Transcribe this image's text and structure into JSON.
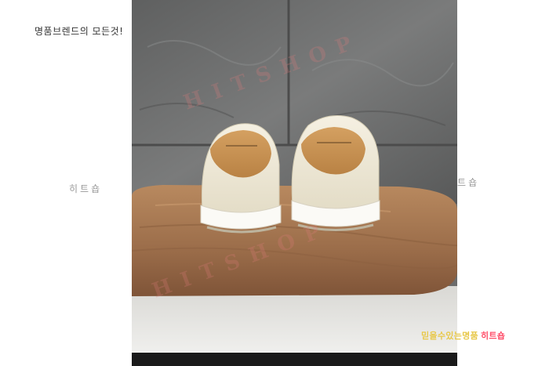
{
  "caption": {
    "top": "명품브렌드의 모든것!"
  },
  "watermarks": {
    "left": "히트숍",
    "right": "히트숍",
    "diagonal": "HITSHOP"
  },
  "photo": {
    "subject": "product-photo",
    "colors": {
      "wall": "#6a6b6b",
      "table": "#a27552",
      "shoe": "#ece6d4",
      "heel_tab": "#c7914f",
      "sole": "#fbfaf6"
    }
  },
  "slogan": {
    "part1": "믿을수있는명품",
    "part2": "히트숍"
  }
}
